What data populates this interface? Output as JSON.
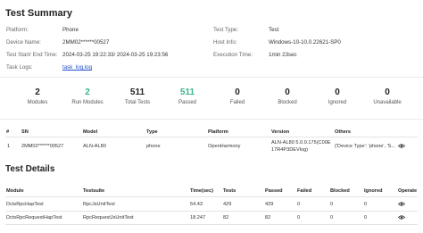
{
  "summary": {
    "title": "Test Summary",
    "platform_label": "Platform:",
    "platform_value": "Phone",
    "device_label": "Device Name:",
    "device_value": "2MM02******00527",
    "time_label": "Test Start/ End Time:",
    "time_value": "2024-03-25 19:22:33/ 2024-03-25 19:23:56",
    "logs_label": "Task Logs:",
    "logs_value": "task_log.log",
    "type_label": "Test Type:",
    "type_value": "Test",
    "host_label": "Host Info:",
    "host_value": "Windows-10-10.0.22621-SP0",
    "exec_label": "Execution Time:",
    "exec_value": "1min 23sec"
  },
  "stats": [
    {
      "value": "2",
      "caption": "Modules"
    },
    {
      "value": "2",
      "caption": "Run Modules"
    },
    {
      "value": "511",
      "caption": "Total Tests"
    },
    {
      "value": "511",
      "caption": "Passed"
    },
    {
      "value": "0",
      "caption": "Failed"
    },
    {
      "value": "0",
      "caption": "Blocked"
    },
    {
      "value": "0",
      "caption": "Ignored"
    },
    {
      "value": "0",
      "caption": "Unavailable"
    }
  ],
  "accent_color": "#3cb48c",
  "devices": {
    "headers": [
      "#",
      "SN",
      "Model",
      "Type",
      "Platform",
      "Version",
      "Others"
    ],
    "row": {
      "index": "1",
      "sn": "2MM02******00527",
      "model": "ALN-AL80",
      "type": "phone",
      "platform": "OpenHarmony",
      "version_line1": "ALN-AL80 5.0.0.175(C00E",
      "version_line2": "17R4P3DEVlog)",
      "others": "{'Device Type': 'phone', 'S..."
    },
    "view_icon": "eye-icon"
  },
  "details": {
    "title": "Test Details",
    "headers": [
      "Module",
      "Testsuite",
      "Time(sec)",
      "Tests",
      "Passed",
      "Failed",
      "Blocked",
      "Ignored",
      "Operate"
    ],
    "rows": [
      {
        "module": "DctsRpcHapTest",
        "testsuite": "RpcJsUnitTest",
        "time": "54.43",
        "tests": "429",
        "passed": "429",
        "failed": "0",
        "blocked": "0",
        "ignored": "0"
      },
      {
        "module": "DctsRpcRequestHapTest",
        "testsuite": "RpcRequestJsUnitTest",
        "time": "18.247",
        "tests": "82",
        "passed": "82",
        "failed": "0",
        "blocked": "0",
        "ignored": "0"
      }
    ],
    "operate_icon": "eye-icon"
  }
}
